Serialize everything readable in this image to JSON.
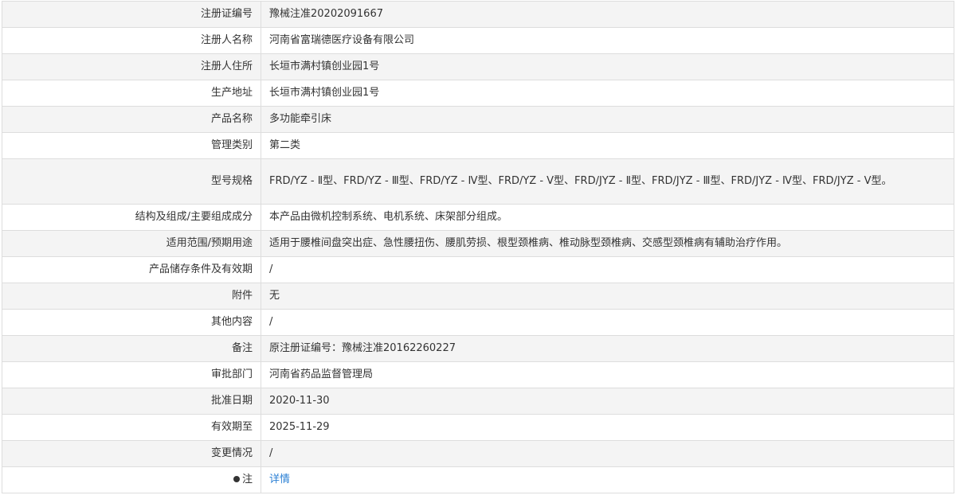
{
  "rows": [
    {
      "label": "注册证编号",
      "value": "豫械注准20202091667"
    },
    {
      "label": "注册人名称",
      "value": "河南省富瑞德医疗设备有限公司"
    },
    {
      "label": "注册人住所",
      "value": "长垣市满村镇创业园1号"
    },
    {
      "label": "生产地址",
      "value": "长垣市满村镇创业园1号"
    },
    {
      "label": "产品名称",
      "value": "多功能牵引床"
    },
    {
      "label": "管理类别",
      "value": "第二类"
    },
    {
      "label": "型号规格",
      "value": "FRD/YZ - Ⅱ型、FRD/YZ - Ⅲ型、FRD/YZ - Ⅳ型、FRD/YZ - V型、FRD/JYZ - Ⅱ型、FRD/JYZ - Ⅲ型、FRD/JYZ - Ⅳ型、FRD/JYZ - V型。"
    },
    {
      "label": "结构及组成/主要组成成分",
      "value": "本产品由微机控制系统、电机系统、床架部分组成。"
    },
    {
      "label": "适用范围/预期用途",
      "value": "适用于腰椎间盘突出症、急性腰扭伤、腰肌劳损、根型颈椎病、椎动脉型颈椎病、交感型颈椎病有辅助治疗作用。"
    },
    {
      "label": "产品储存条件及有效期",
      "value": "/"
    },
    {
      "label": "附件",
      "value": "无"
    },
    {
      "label": "其他内容",
      "value": "/"
    },
    {
      "label": "备注",
      "value": "原注册证编号：豫械注准20162260227"
    },
    {
      "label": "审批部门",
      "value": "河南省药品监督管理局"
    },
    {
      "label": "批准日期",
      "value": "2020-11-30"
    },
    {
      "label": "有效期至",
      "value": "2025-11-29"
    },
    {
      "label": "变更情况",
      "value": "/"
    }
  ],
  "note": {
    "label": "注",
    "icon": "lightbulb-icon",
    "link_text": "详情",
    "link_color": "#2a7fd4"
  }
}
